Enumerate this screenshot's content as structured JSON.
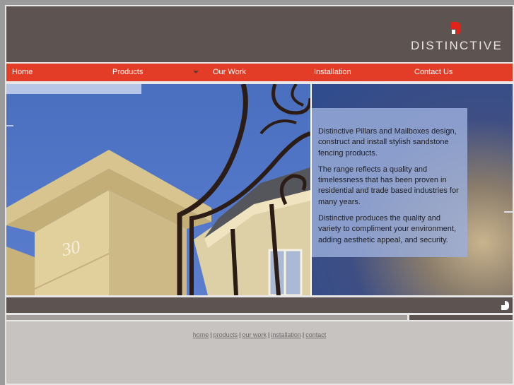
{
  "brand": {
    "name": "DISTINCTIVE",
    "accent_color": "#e43d27",
    "header_color": "#5d5452"
  },
  "nav": {
    "items": [
      {
        "label": "Home",
        "has_dropdown": false
      },
      {
        "label": "Products",
        "has_dropdown": true
      },
      {
        "label": "Our Work",
        "has_dropdown": false
      },
      {
        "label": "Installation",
        "has_dropdown": false
      },
      {
        "label": "Contact Us",
        "has_dropdown": false
      }
    ]
  },
  "hero": {
    "image_left_alt": "Sandstone pillar numbered 30 beside a wrought iron gate",
    "pillar_number": "30",
    "paragraphs": [
      "Distinctive Pillars and Mailboxes design, construct and install stylish sandstone fencing products.",
      "The range reflects a quality and timelessness that has been proven in residential and trade based industries for many years.",
      "Distinctive produces the quality and variety to compliment your environment, adding aesthetic appeal, and security."
    ]
  },
  "footer": {
    "links": [
      "home",
      "products",
      "our work",
      "installation",
      "contact"
    ],
    "separator": "|"
  }
}
